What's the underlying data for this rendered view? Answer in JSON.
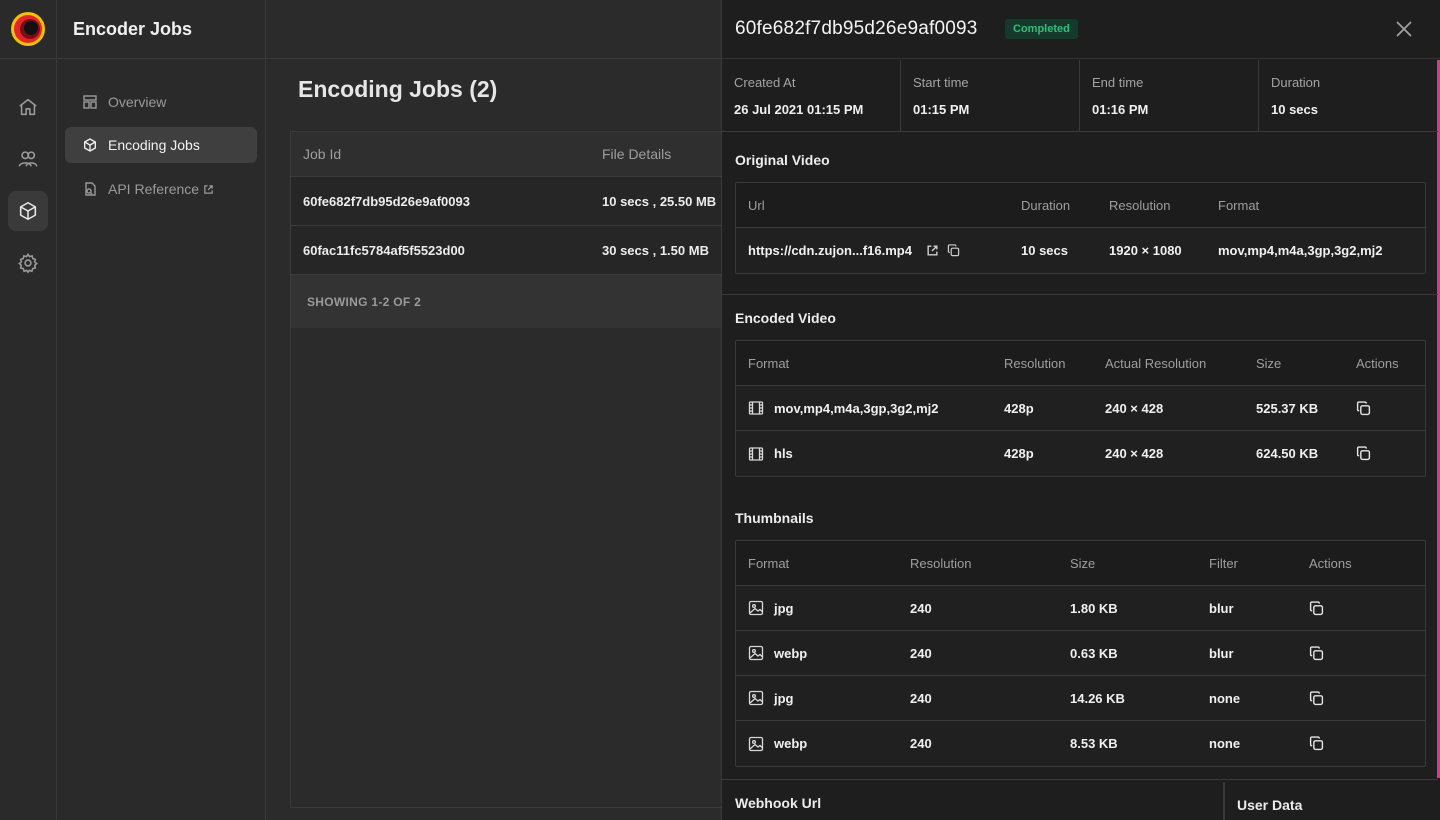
{
  "app": {
    "title": "Encoder Jobs"
  },
  "rail": {
    "icons": [
      "home-icon",
      "users-icon",
      "cube-icon",
      "settings-icon"
    ],
    "active": "cube-icon"
  },
  "nav": {
    "items": [
      {
        "label": "Overview",
        "icon": "layout-icon"
      },
      {
        "label": "Encoding Jobs",
        "icon": "cube-icon",
        "active": true
      },
      {
        "label": "API Reference",
        "icon": "doc-icon",
        "external": true
      }
    ]
  },
  "main": {
    "title": "Encoding Jobs (2)",
    "columns": [
      "Job Id",
      "File Details"
    ],
    "rows": [
      {
        "job_id": "60fe682f7db95d26e9af0093",
        "file_details": "10 secs , 25.50 MB"
      },
      {
        "job_id": "60fac11fc5784af5f5523d00",
        "file_details": "30 secs , 1.50 MB"
      }
    ],
    "footer": "SHOWING 1-2 OF 2"
  },
  "drawer": {
    "job_id": "60fe682f7db95d26e9af0093",
    "status": "Completed",
    "colors": {
      "accent": "#e0358b",
      "status_text": "#2fbf7c",
      "status_bg": "#143a2b"
    },
    "meta": [
      {
        "label": "Created At",
        "value": "26 Jul 2021 01:15 PM"
      },
      {
        "label": "Start time",
        "value": "01:15 PM"
      },
      {
        "label": "End time",
        "value": "01:16 PM"
      },
      {
        "label": "Duration",
        "value": "10 secs"
      }
    ],
    "original_video": {
      "title": "Original Video",
      "columns": [
        "Url",
        "Duration",
        "Resolution",
        "Format"
      ],
      "row": {
        "url": "https://cdn.zujon...f16.mp4",
        "duration": "10 secs",
        "resolution": "1920 × 1080",
        "format": "mov,mp4,m4a,3gp,3g2,mj2"
      }
    },
    "encoded_video": {
      "title": "Encoded Video",
      "columns": [
        "Format",
        "Resolution",
        "Actual Resolution",
        "Size",
        "Actions"
      ],
      "rows": [
        {
          "format": "mov,mp4,m4a,3gp,3g2,mj2",
          "resolution": "428p",
          "actual_resolution": "240 × 428",
          "size": "525.37 KB"
        },
        {
          "format": "hls",
          "resolution": "428p",
          "actual_resolution": "240 × 428",
          "size": "624.50 KB"
        }
      ]
    },
    "thumbnails": {
      "title": "Thumbnails",
      "columns": [
        "Format",
        "Resolution",
        "Size",
        "Filter",
        "Actions"
      ],
      "rows": [
        {
          "format": "jpg",
          "resolution": "240",
          "size": "1.80 KB",
          "filter": "blur"
        },
        {
          "format": "webp",
          "resolution": "240",
          "size": "0.63 KB",
          "filter": "blur"
        },
        {
          "format": "jpg",
          "resolution": "240",
          "size": "14.26 KB",
          "filter": "none"
        },
        {
          "format": "webp",
          "resolution": "240",
          "size": "8.53 KB",
          "filter": "none"
        }
      ]
    },
    "webhook_title": "Webhook Url",
    "user_data_title": "User Data"
  }
}
